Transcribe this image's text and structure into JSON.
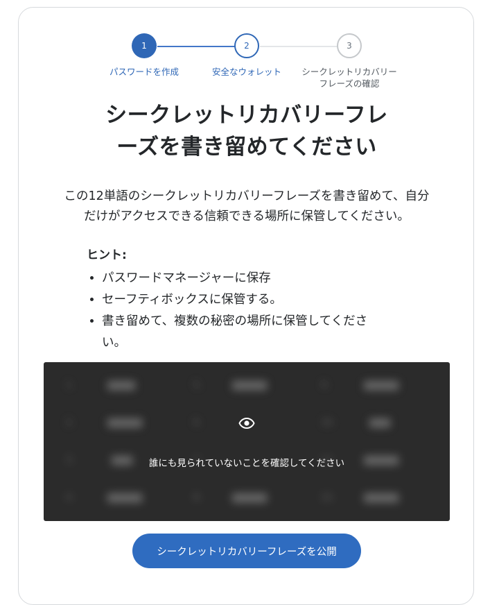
{
  "stepper": {
    "steps": [
      {
        "number": "1",
        "label": "パスワードを作成"
      },
      {
        "number": "2",
        "label": "安全なウォレット"
      },
      {
        "number": "3",
        "label": "シークレットリカバリーフレーズの確認"
      }
    ]
  },
  "title": {
    "line1": "シークレットリカバリーフレ",
    "line2": "ーズを書き留めてください"
  },
  "description": {
    "line1": "この12単語のシークレットリカバリーフレーズを書き留めて、自分",
    "line2": "だけがアクセスできる信頼できる場所に保管してください。"
  },
  "hints": {
    "title": "ヒント:",
    "items": [
      "パスワードマネージャーに保存",
      "セーフティボックスに保管する。",
      "書き留めて、複数の秘密の場所に保管してくださ い。"
    ]
  },
  "reveal": {
    "icon": "eye-icon",
    "message": "誰にも見られていないことを確認してください"
  },
  "reveal_button": {
    "label": "シークレットリカバリーフレーズを公開"
  },
  "colors": {
    "primary": "#2f6cc0",
    "overlay": "#2b2b2b",
    "text": "#24272a"
  }
}
